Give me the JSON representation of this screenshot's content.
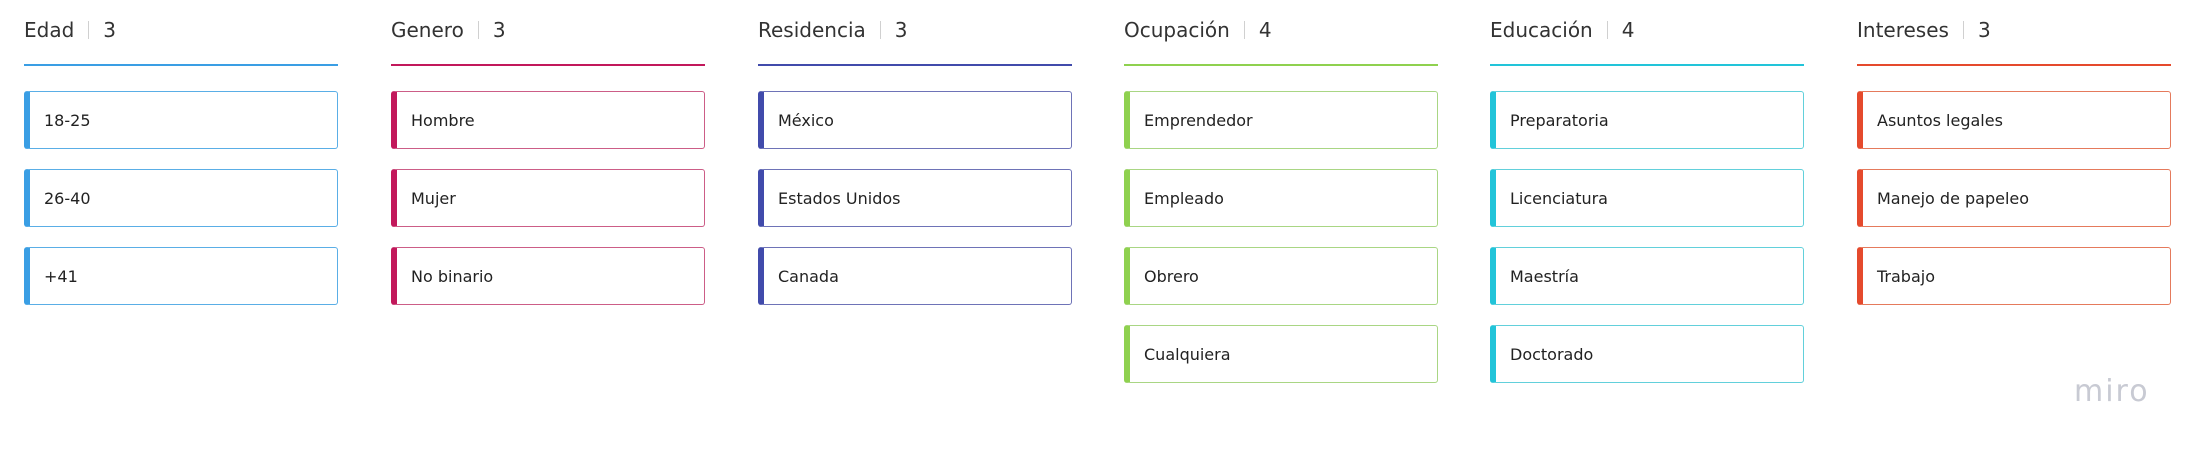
{
  "board": {
    "logo_text": "miro",
    "columns": [
      {
        "title": "Edad",
        "count": "3",
        "accent": "#3a9ee4",
        "card_border": "#5aaee6",
        "items": [
          {
            "label": "18-25"
          },
          {
            "label": "26-40"
          },
          {
            "label": "+41"
          }
        ]
      },
      {
        "title": "Genero",
        "count": "3",
        "accent": "#c2185b",
        "card_border": "#cc5d87",
        "items": [
          {
            "label": "Hombre"
          },
          {
            "label": "Mujer"
          },
          {
            "label": "No binario"
          }
        ]
      },
      {
        "title": "Residencia",
        "count": "3",
        "accent": "#414bab",
        "card_border": "#6e73b7",
        "items": [
          {
            "label": "México"
          },
          {
            "label": "Estados Unidos"
          },
          {
            "label": "Canada"
          }
        ]
      },
      {
        "title": "Ocupación",
        "count": "4",
        "accent": "#8fd14f",
        "card_border": "#a9d684",
        "items": [
          {
            "label": "Emprendedor"
          },
          {
            "label": "Empleado"
          },
          {
            "label": "Obrero"
          },
          {
            "label": "Cualquiera"
          }
        ]
      },
      {
        "title": "Educación",
        "count": "4",
        "accent": "#22c4d9",
        "card_border": "#62d0db",
        "items": [
          {
            "label": "Preparatoria"
          },
          {
            "label": "Licenciatura"
          },
          {
            "label": "Maestría"
          },
          {
            "label": "Doctorado"
          }
        ]
      },
      {
        "title": "Intereses",
        "count": "3",
        "accent": "#e54a2d",
        "card_border": "#e57a5c",
        "items": [
          {
            "label": "Asuntos legales"
          },
          {
            "label": "Manejo de papeleo"
          },
          {
            "label": "Trabajo"
          }
        ]
      }
    ]
  }
}
